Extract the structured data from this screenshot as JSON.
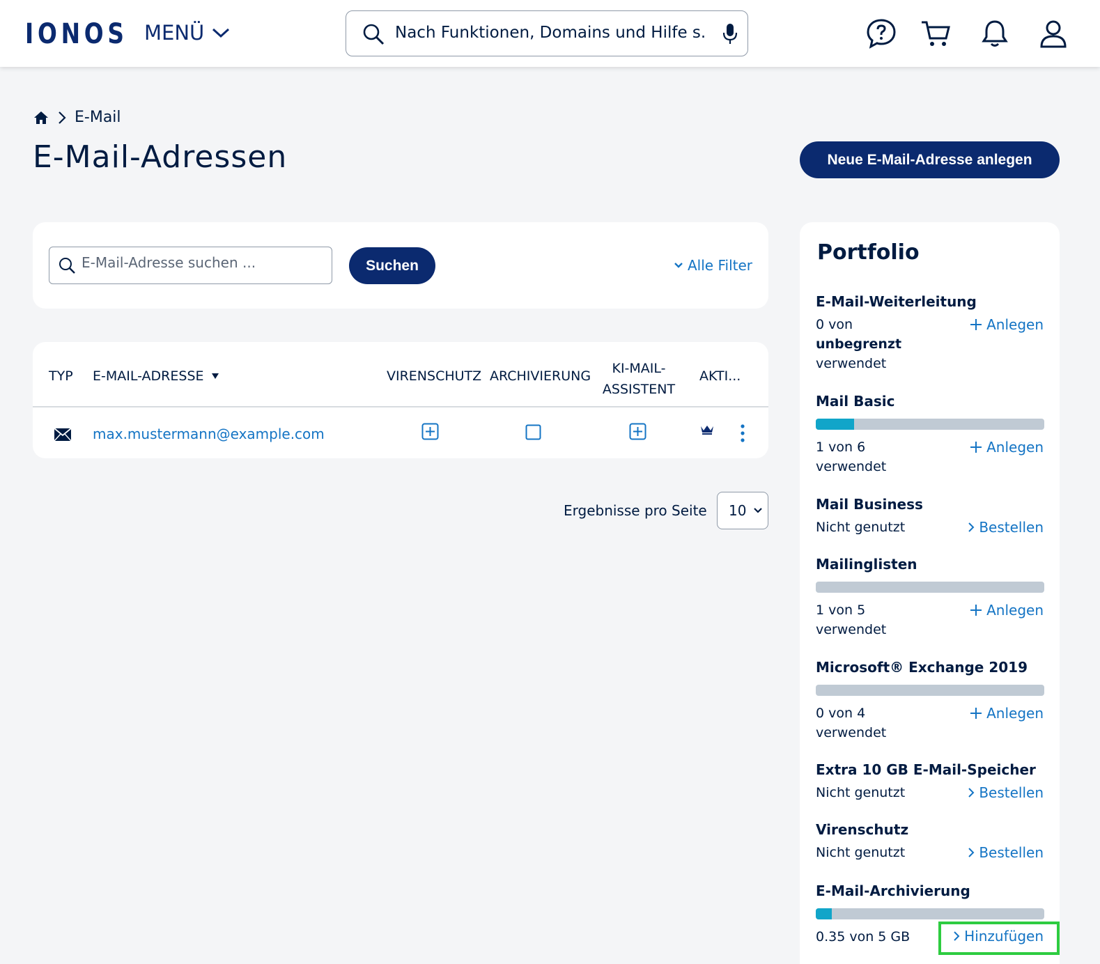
{
  "header": {
    "logo": "IONOS",
    "menu_label": "MENÜ",
    "search_placeholder": "Nach Funktionen, Domains und Hilfe s...",
    "icons": [
      "help-chat-icon",
      "cart-icon",
      "bell-icon",
      "user-icon"
    ]
  },
  "breadcrumb": {
    "home_icon": "home-icon",
    "current": "E-Mail"
  },
  "page": {
    "title": "E-Mail-Adressen",
    "new_button": "Neue E-Mail-Adresse anlegen"
  },
  "filter": {
    "search_placeholder": "E-Mail-Adresse suchen ...",
    "search_button": "Suchen",
    "all_filters": "Alle Filter"
  },
  "table": {
    "columns": {
      "typ": "TYP",
      "email": "E-MAIL-ADRESSE",
      "virenschutz": "VIRENSCHUTZ",
      "archivierung": "ARCHIVIERUNG",
      "ki_line1": "KI-MAIL-",
      "ki_line2": "ASSISTENT",
      "aktionen": "AKTI..."
    },
    "rows": [
      {
        "type_icon": "envelope-icon",
        "email": "max.mustermann@example.com",
        "virenschutz": "add",
        "archivierung": "unchecked",
        "ki": "add",
        "premium_icon": "crown-icon"
      }
    ]
  },
  "pagination": {
    "label": "Ergebnisse pro Seite",
    "value": "10"
  },
  "portfolio": {
    "title": "Portfolio",
    "items": [
      {
        "name": "E-Mail-Weiterleitung",
        "line1": "0 von",
        "line2": "unbegrenzt",
        "line3": "verwendet",
        "action": "Anlegen"
      },
      {
        "name": "Mail Basic",
        "usage": "1 von 6",
        "used_label": "verwendet",
        "fraction": 0.1667,
        "action": "Anlegen"
      },
      {
        "name": "Mail Business",
        "status": "Nicht genutzt",
        "action": "Bestellen"
      },
      {
        "name": "Mailinglisten",
        "usage": "1 von 5",
        "used_label": "verwendet",
        "fraction": 0.0,
        "action": "Anlegen"
      },
      {
        "name": "Microsoft® Exchange 2019",
        "usage": "0 von 4",
        "used_label": "verwendet",
        "fraction": 0.0,
        "action": "Anlegen"
      },
      {
        "name": "Extra 10 GB E-Mail-Speicher",
        "status": "Nicht genutzt",
        "action": "Bestellen"
      },
      {
        "name": "Virenschutz",
        "status": "Nicht genutzt",
        "action": "Bestellen"
      },
      {
        "name": "E-Mail-Archivierung",
        "usage": "0.35 von 5 GB",
        "fraction": 0.07,
        "action": "Hinzufügen"
      }
    ]
  },
  "colors": {
    "brand": "#0b2a6f",
    "link": "#1474c4",
    "bar_fill": "#11a5c9",
    "highlight": "#2ecc40"
  }
}
